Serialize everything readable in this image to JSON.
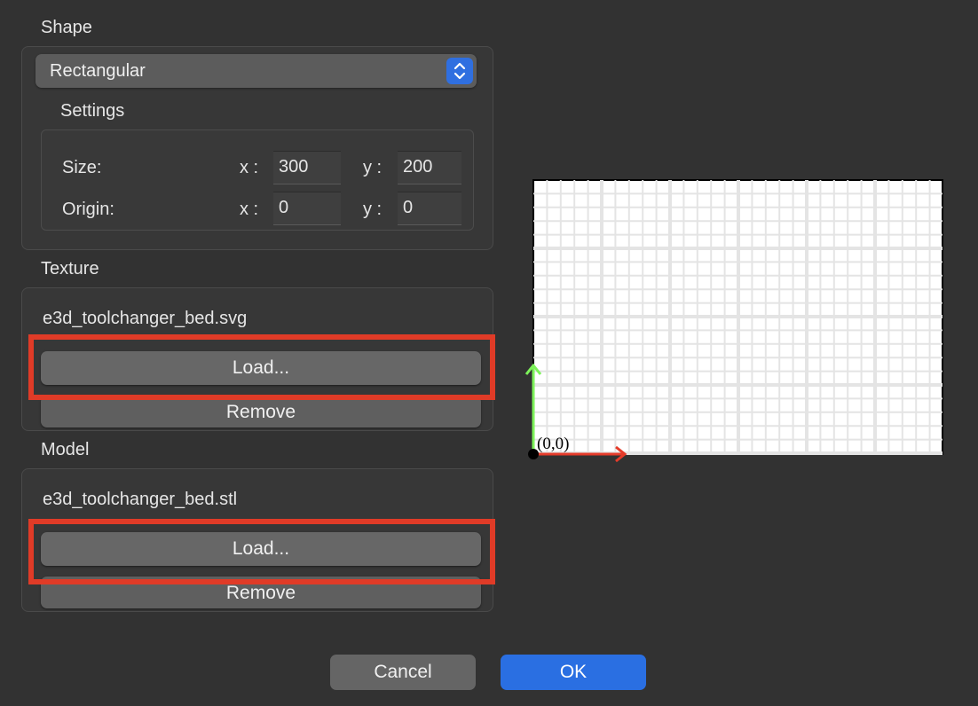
{
  "shape": {
    "title": "Shape",
    "select_value": "Rectangular",
    "settings": {
      "title": "Settings",
      "size_label": "Size:",
      "origin_label": "Origin:",
      "x_label": "x :",
      "y_label": "y :",
      "size_x": "300",
      "size_y": "200",
      "origin_x": "0",
      "origin_y": "0"
    }
  },
  "texture": {
    "title": "Texture",
    "filename": "e3d_toolchanger_bed.svg",
    "load_label": "Load...",
    "remove_label": "Remove"
  },
  "model": {
    "title": "Model",
    "filename": "e3d_toolchanger_bed.stl",
    "load_label": "Load...",
    "remove_label": "Remove"
  },
  "preview": {
    "origin_label": "(0,0)"
  },
  "footer": {
    "cancel_label": "Cancel",
    "ok_label": "OK"
  },
  "colors": {
    "accent": "#2a6fe2",
    "highlight": "#e03b27",
    "x_axis": "#e53b2a",
    "y_axis": "#7df25a"
  }
}
